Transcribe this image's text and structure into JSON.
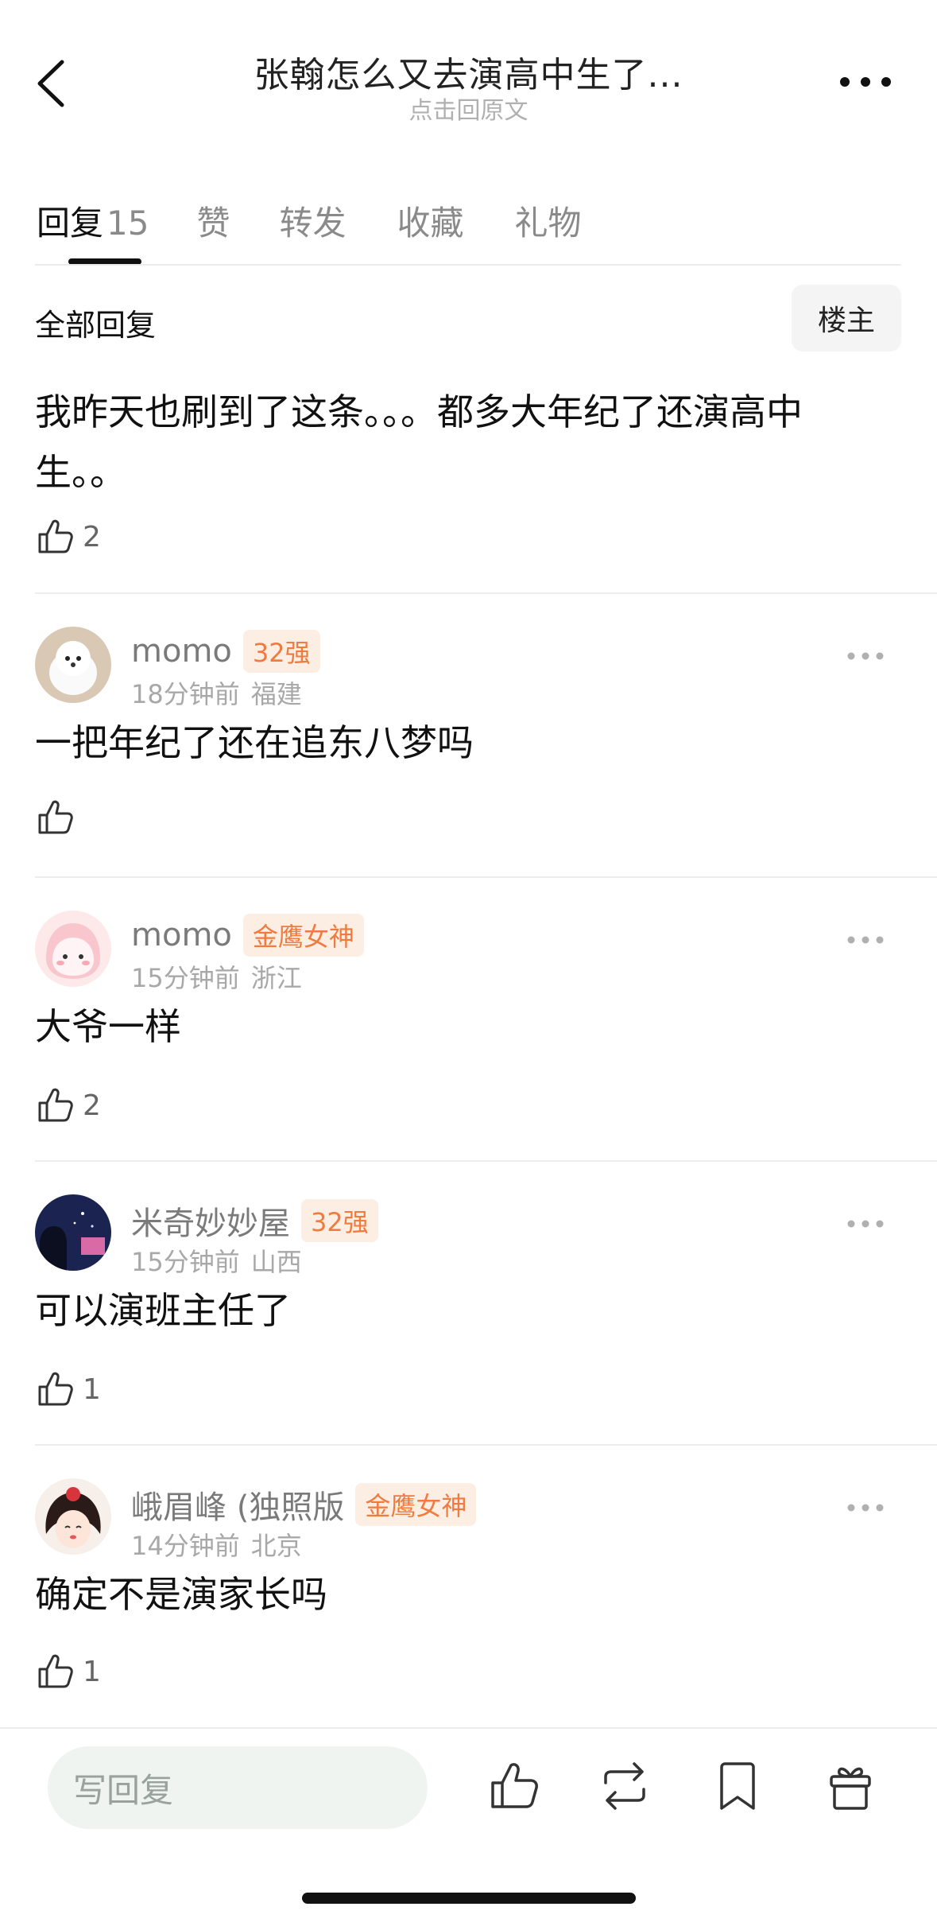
{
  "header": {
    "title": "张翰怎么又去演高中生了...",
    "subtitle": "点击回原文"
  },
  "tabs": [
    {
      "label": "回复",
      "count": "15"
    },
    {
      "label": "赞"
    },
    {
      "label": "转发"
    },
    {
      "label": "收藏"
    },
    {
      "label": "礼物"
    }
  ],
  "section": {
    "title": "全部回复",
    "owner_button": "楼主"
  },
  "original": {
    "text": "我昨天也刷到了这条。。。都多大年纪了还演高中生。。",
    "likes": "2"
  },
  "comments": [
    {
      "user": "momo",
      "badge": "32强",
      "time": "18分钟前",
      "location": "福建",
      "text": "一把年纪了还在追东八梦吗",
      "likes": ""
    },
    {
      "user": "momo",
      "badge": "金鹰女神",
      "time": "15分钟前",
      "location": "浙江",
      "text": "大爷一样",
      "likes": "2"
    },
    {
      "user": "米奇妙妙屋",
      "badge": "32强",
      "time": "15分钟前",
      "location": "山西",
      "text": "可以演班主任了",
      "likes": "1"
    },
    {
      "user": "峨眉峰 (独照版",
      "badge": "金鹰女神",
      "time": "14分钟前",
      "location": "北京",
      "text": "确定不是演家长吗",
      "likes": "1"
    }
  ],
  "bottom_bar": {
    "reply_placeholder": "写回复",
    "icons": [
      "like-icon",
      "repost-icon",
      "bookmark-icon",
      "gift-icon"
    ]
  },
  "colors": {
    "badge_text": "#f07b3f",
    "badge_bg": "#fdeee4",
    "reply_input_bg": "#eff4f1"
  }
}
